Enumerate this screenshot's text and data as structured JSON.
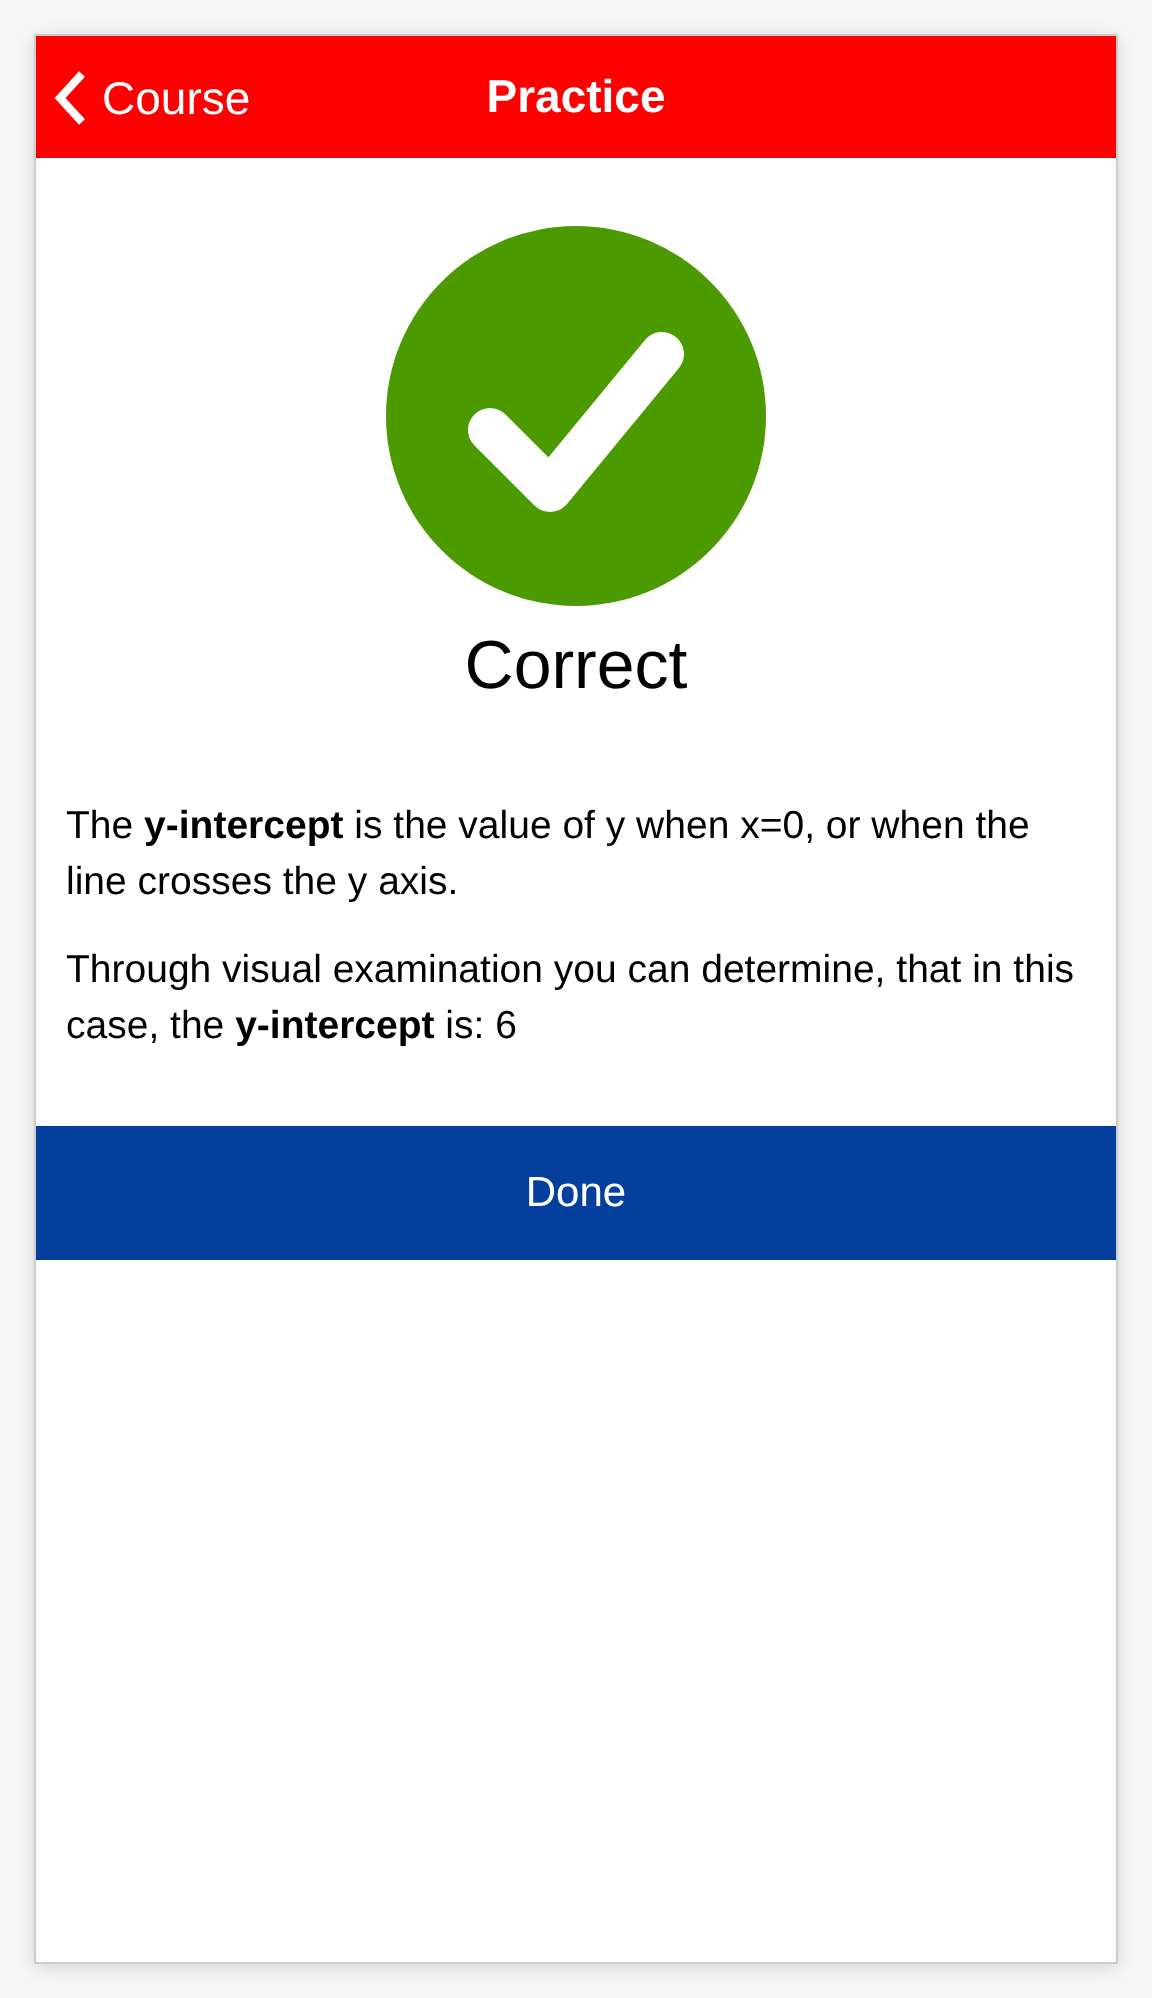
{
  "nav_bar": {
    "back_label": "Course",
    "title": "Practice"
  },
  "result": {
    "title": "Correct"
  },
  "explanation": [
    "The **y-intercept** is the value of y when x=0, or when the line crosses the y axis.",
    "Through visual examination you can determine, that in this case, the **y-intercept** is: 6"
  ],
  "done_button": "Done"
}
